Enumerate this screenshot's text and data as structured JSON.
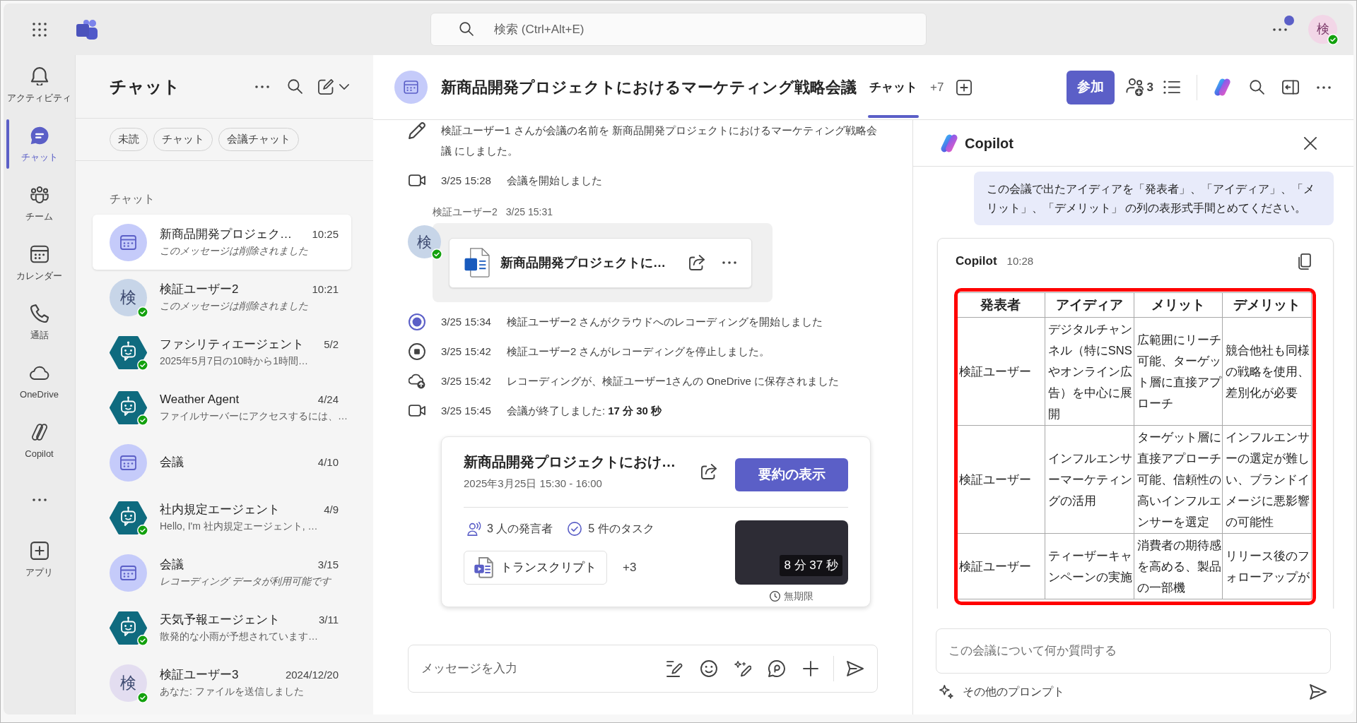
{
  "top_bar": {
    "search": {
      "placeholder": "検索 (Ctrl+Alt+E)"
    },
    "more_badge": true,
    "account": {
      "initial": "検",
      "color": "#f2d6e7",
      "available": true
    }
  },
  "rail": {
    "items": [
      {
        "label": "アクティビティ",
        "selected": false
      },
      {
        "label": "チャット",
        "selected": true
      },
      {
        "label": "チーム",
        "selected": false
      },
      {
        "label": "カレンダー",
        "selected": false
      },
      {
        "label": "通話",
        "selected": false
      },
      {
        "label": "OneDrive",
        "selected": false
      },
      {
        "label": "Copilot",
        "selected": false
      }
    ],
    "apps": {
      "label": "アプリ",
      "selected": false
    }
  },
  "chat_list": {
    "title": "チャット",
    "filters": [
      {
        "label": "未読",
        "selected": false
      },
      {
        "label": "チャット",
        "selected": false
      },
      {
        "label": "会議チャット",
        "selected": false
      }
    ],
    "section": "チャット",
    "items": [
      {
        "avatar": {
          "kind": "meeting"
        },
        "name": "新商品開発プロジェク…",
        "time": "10:25",
        "preview": "このメッセージは削除されました",
        "preview_italic": true,
        "selected": true
      },
      {
        "avatar": {
          "kind": "person",
          "initial": "検",
          "color": "#c7d5e8",
          "available": true
        },
        "name": "検証ユーザー2",
        "time": "10:21",
        "preview": "このメッセージは削除されました",
        "preview_italic": true,
        "selected": false
      },
      {
        "avatar": {
          "kind": "agent",
          "available": true
        },
        "name": "ファシリティエージェント",
        "time": "5/2",
        "preview": "2025年5月7日の10時から1時間…",
        "preview_italic": false,
        "selected": false
      },
      {
        "avatar": {
          "kind": "agent",
          "available": true
        },
        "name": "Weather Agent",
        "time": "4/24",
        "preview": "ファイルサーバーにアクセスするには、…",
        "preview_italic": false,
        "selected": false
      },
      {
        "avatar": {
          "kind": "meeting"
        },
        "name": "会議",
        "time": "4/10",
        "selected": false
      },
      {
        "avatar": {
          "kind": "agent",
          "available": true
        },
        "name": "社内規定エージェント",
        "time": "4/9",
        "preview": "Hello, I'm 社内規定エージェント, …",
        "preview_italic": false,
        "selected": false
      },
      {
        "avatar": {
          "kind": "meeting"
        },
        "name": "会議",
        "time": "3/15",
        "preview": "レコーディング データが利用可能です",
        "preview_italic": true,
        "selected": false
      },
      {
        "avatar": {
          "kind": "agent",
          "available": true
        },
        "name": "天気予報エージェント",
        "time": "3/11",
        "preview": "散発的な小雨が予想されています…",
        "preview_italic": false,
        "selected": false
      },
      {
        "avatar": {
          "kind": "person",
          "initial": "検",
          "color": "#e3ddf0",
          "available": true
        },
        "name": "検証ユーザー3",
        "time": "2024/12/20",
        "preview": "あなた: ファイルを送信しました",
        "preview_italic": false,
        "selected": false
      }
    ]
  },
  "conversation": {
    "avatar": {
      "kind": "meeting"
    },
    "title": "新商品開発プロジェクトにおけるマーケティング戦略会議",
    "tabs": [
      {
        "label": "チャット",
        "selected": true
      }
    ],
    "more_tabs": "+7",
    "join_button": "参加",
    "participants": "3"
  },
  "timeline": [
    {
      "kind": "rename",
      "text": "検証ユーザー1 さんが会議の名前を 新商品開発プロジェクトにおけるマーケティング戦略会議 にしました。"
    },
    {
      "kind": "meeting_start",
      "time": "3/25 15:28",
      "text": "会議を開始しました"
    },
    {
      "kind": "message",
      "sender": "検証ユーザー2",
      "time": "3/25 15:31",
      "avatar": {
        "kind": "person",
        "initial": "検",
        "color": "#c7d5e8",
        "available": true
      },
      "attachment": {
        "name": "新商品開発プロジェクトに…"
      }
    },
    {
      "kind": "recording_start",
      "time": "3/25 15:34",
      "text": "検証ユーザー2 さんがクラウドへのレコーディングを開始しました"
    },
    {
      "kind": "recording_stop",
      "time": "3/25 15:42",
      "text": "検証ユーザー2 さんがレコーディングを停止しました。"
    },
    {
      "kind": "recording_saved",
      "time": "3/25 15:42",
      "text": "レコーディングが、検証ユーザー1さんの OneDrive に保存されました"
    },
    {
      "kind": "meeting_end",
      "time": "3/25 15:45",
      "text": "会議が終了しました: **17 分 30 秒**"
    },
    {
      "kind": "recap",
      "title": "新商品開発プロジェクトにおけ…",
      "date": "2025年3月25日 15:30 - 16:00",
      "button": "要約の表示",
      "speakers": "3 人の発言者",
      "tasks": "5 件のタスク",
      "transcript": "トランスクリプト",
      "more_files": "+3",
      "duration": "8 分 37 秒",
      "retention": "無期限"
    }
  ],
  "composer": {
    "placeholder": "メッセージを入力"
  },
  "copilot": {
    "title": "Copilot",
    "messages": [
      {
        "kind": "prompt",
        "text": "この会議で出たアイディアを「発表者」、「アイディア」、「メリット」、「デメリット」 の列の表形式手間とめてください。"
      },
      {
        "kind": "response",
        "sender": "Copilot",
        "time": "10:28",
        "table": {
          "highlighted": true,
          "columns": [
            "発表者",
            "アイディア",
            "メリット",
            "デメリット"
          ],
          "rows": [
            [
              "検証ユーザー",
              "デジタルチャンネル（特にSNSやオンライン広告）を中心に展開",
              "広範囲にリーチ可能、ターゲット層に直接アプローチ",
              "競合他社も同様の戦略を使用、差別化が必要"
            ],
            [
              "検証ユーザー",
              "インフルエンサーマーケティングの活用",
              "ターゲット層に直接アプローチ可能、信頼性の高いインフルエンサーを選定",
              "インフルエンサーの選定が難しい、ブランドイメージに悪影響の可能性"
            ],
            [
              "検証ユーザー",
              "ティーザーキャンペーンの実施",
              "消費者の期待感を高める、製品の一部機",
              "リリース後のフォローアップが"
            ]
          ]
        }
      }
    ],
    "input": {
      "placeholder": "この会議について何か質問する"
    },
    "more_prompts": "その他のプロンプト"
  }
}
